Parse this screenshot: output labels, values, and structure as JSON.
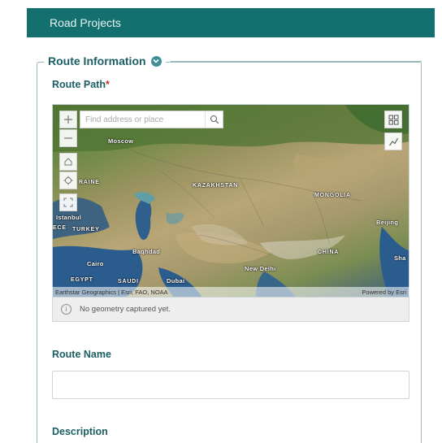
{
  "header": {
    "title": "Road Projects"
  },
  "section": {
    "title": "Route Information"
  },
  "route_path": {
    "label": "Route Path",
    "required_marker": "*",
    "map": {
      "search_placeholder": "Find address or place",
      "labels": {
        "moscow": "Moscow",
        "kazakhstan": "KAZAKHSTAN",
        "mongolia": "MONGOLIA",
        "raine": "RAINE",
        "istanbul": "Istanbul",
        "turkey": "TURKEY",
        "beijing": "Beijing",
        "baghdad": "Baghdad",
        "cairo": "Cairo",
        "new_delhi": "New Delhi",
        "china": "CHINA",
        "sha": "Sha",
        "egypt": "EGYPT",
        "saudi": "SAUDI",
        "dubai": "Dubai",
        "ece": "ECE"
      },
      "attribution": "Earthstar Geographics | Esri, FAO, NOAA",
      "powered_by": "Powered by Esri"
    },
    "status_message": "No geometry captured yet."
  },
  "route_name": {
    "label": "Route Name",
    "value": ""
  },
  "description": {
    "label": "Description"
  }
}
